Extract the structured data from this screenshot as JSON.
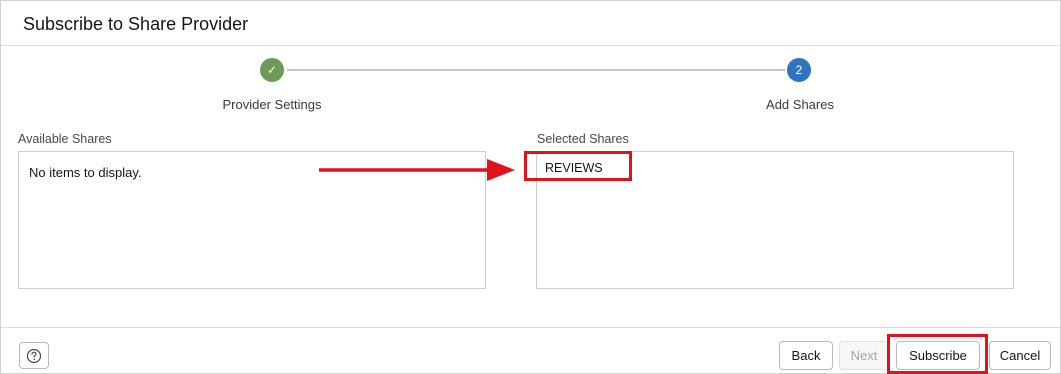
{
  "dialog": {
    "title": "Subscribe to Share Provider"
  },
  "stepper": {
    "steps": [
      {
        "number": "✓",
        "label": "Provider Settings",
        "status": "complete"
      },
      {
        "number": "2",
        "label": "Add Shares",
        "status": "current"
      }
    ]
  },
  "available_shares": {
    "title": "Available Shares",
    "empty_text": "No items to display."
  },
  "selected_shares": {
    "title": "Selected Shares",
    "items": [
      "REVIEWS"
    ]
  },
  "footer": {
    "help_icon": "question-circle-icon",
    "back_label": "Back",
    "next_label": "Next",
    "subscribe_label": "Subscribe",
    "cancel_label": "Cancel"
  },
  "colors": {
    "step_complete": "#6e9a57",
    "step_current": "#2f74c0",
    "annotation": "#e0131a"
  }
}
